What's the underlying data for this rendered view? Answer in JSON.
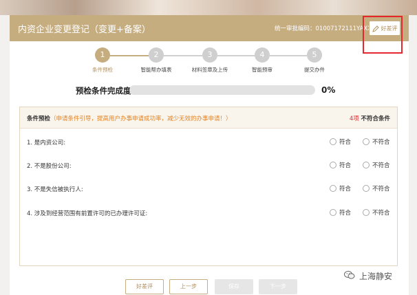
{
  "header": {
    "title": "内资企业变更登记（变更+备案）",
    "credit_code": "统一审批编码：01007172111YAXX",
    "review_button": "好差评",
    "review_icon": "pencil-icon",
    "bg_color": "#c6ad80"
  },
  "steps": [
    {
      "num": "1",
      "label": "条件预检",
      "active": true
    },
    {
      "num": "2",
      "label": "智能帮办填表",
      "active": false
    },
    {
      "num": "3",
      "label": "材料签章及上传",
      "active": false
    },
    {
      "num": "4",
      "label": "智能预审",
      "active": false
    },
    {
      "num": "5",
      "label": "提交办件",
      "active": false
    }
  ],
  "progress": {
    "label": "预检条件完成度",
    "value_text": "0%",
    "fraction": 0
  },
  "panel": {
    "title_bold": "条件预检",
    "title_note": "（申请条件引导，提高用户办事申请成功率，减少无效的办事申请！）",
    "fail_count": "4项",
    "fail_label": "不符合条件",
    "questions": [
      {
        "text": "1. 是内资公司:"
      },
      {
        "text": "2. 不是股份公司:"
      },
      {
        "text": "3. 不是失信被执行人:"
      },
      {
        "text": "4. 涉及到经营范围有前置许可的已办理许可证:"
      }
    ],
    "option_yes": "符合",
    "option_no": "不符合"
  },
  "buttons": {
    "review": "好差评",
    "prev": "上一步",
    "save": "保存",
    "next": "下一步"
  },
  "watermark": {
    "text": "上海静安",
    "icon": "wechat-icon"
  },
  "colors": {
    "accent": "#c6ad80",
    "highlight": "#e4272f",
    "note": "#e0842a"
  }
}
